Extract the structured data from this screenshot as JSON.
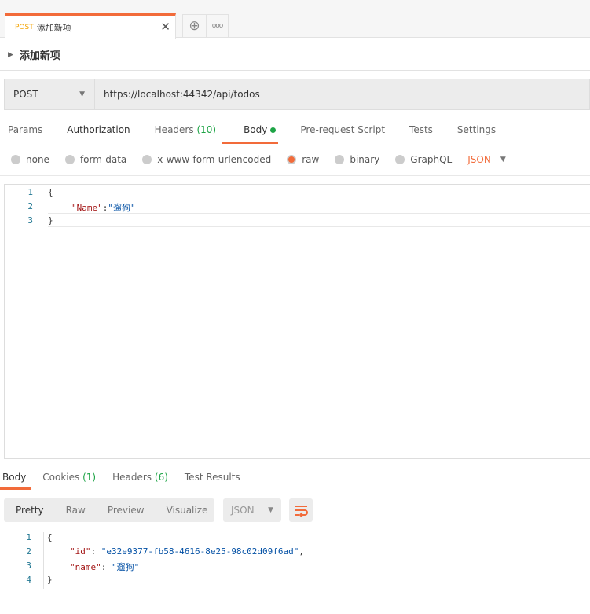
{
  "tab": {
    "method": "POST",
    "name": "添加新项"
  },
  "request": {
    "title": "添加新项",
    "method": "POST",
    "url": "https://localhost:44342/api/todos"
  },
  "req_tabs": [
    {
      "label": "Params"
    },
    {
      "label": "Authorization"
    },
    {
      "label": "Headers",
      "count": "(10)"
    },
    {
      "label": "Body"
    },
    {
      "label": "Pre-request Script"
    },
    {
      "label": "Tests"
    },
    {
      "label": "Settings"
    }
  ],
  "body_types": [
    "none",
    "form-data",
    "x-www-form-urlencoded",
    "raw",
    "binary",
    "GraphQL"
  ],
  "body_format": "JSON",
  "request_body": {
    "lines": [
      "1",
      "2",
      "3"
    ],
    "open": "{",
    "key": "\"Name\"",
    "colon": ":",
    "value": "\"遛狗\"",
    "close": "}"
  },
  "resp_tabs": [
    {
      "label": "Body"
    },
    {
      "label": "Cookies",
      "count": "(1)"
    },
    {
      "label": "Headers",
      "count": "(6)"
    },
    {
      "label": "Test Results"
    }
  ],
  "resp_views": [
    "Pretty",
    "Raw",
    "Preview",
    "Visualize"
  ],
  "resp_format": "JSON",
  "response_body": {
    "lines": [
      "1",
      "2",
      "3",
      "4"
    ],
    "open": "{",
    "id_key": "\"id\"",
    "id_value": "\"e32e9377-fb58-4616-8e25-98c02d09f6ad\"",
    "name_key": "\"name\"",
    "name_value": "\"遛狗\"",
    "close": "}"
  },
  "colors": {
    "accent": "#f26b3a",
    "green": "#1ea446",
    "method_tag": "#f4a300"
  }
}
